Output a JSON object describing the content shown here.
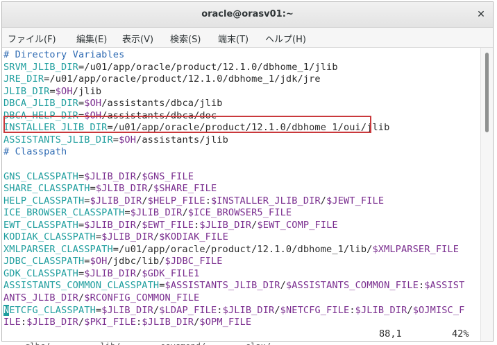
{
  "window": {
    "title": "oracle@orasv01:~"
  },
  "menu": [
    "ファイル(F)",
    "編集(E)",
    "表示(V)",
    "検索(S)",
    "端末(T)",
    "ヘルプ(H)"
  ],
  "lines": [
    [
      {
        "t": "# Directory Variables",
        "k": "c"
      }
    ],
    [
      {
        "t": "SRVM_JLIB_DIR",
        "k": "v"
      },
      {
        "t": "=/u01/app/oracle/product/12.1.0/dbhome_1/jlib",
        "k": "p"
      }
    ],
    [
      {
        "t": "JRE_DIR",
        "k": "v"
      },
      {
        "t": "=/u01/app/oracle/product/12.1.0/dbhome_1/jdk/jre",
        "k": "p"
      }
    ],
    [
      {
        "t": "JLIB_DIR",
        "k": "v"
      },
      {
        "t": "=",
        "k": "p"
      },
      {
        "t": "$OH",
        "k": "s"
      },
      {
        "t": "/jlib",
        "k": "p"
      }
    ],
    [
      {
        "t": "DBCA_JLIB_DIR",
        "k": "v"
      },
      {
        "t": "=",
        "k": "p"
      },
      {
        "t": "$OH",
        "k": "s"
      },
      {
        "t": "/assistants/dbca/jlib",
        "k": "p"
      }
    ],
    [
      {
        "t": "DBCA_HELP_DIR",
        "k": "v"
      },
      {
        "t": "=",
        "k": "p"
      },
      {
        "t": "$OH",
        "k": "s"
      },
      {
        "t": "/assistants/dbca/doc",
        "k": "p"
      }
    ],
    [
      {
        "t": "INSTALLER_JLIB_DIR",
        "k": "v"
      },
      {
        "t": "=/u01/app/oracle/product/12.1.0/dbhome_1/oui/jlib",
        "k": "p"
      }
    ],
    [
      {
        "t": "ASSISTANTS_JLIB_DIR",
        "k": "v"
      },
      {
        "t": "=",
        "k": "p"
      },
      {
        "t": "$OH",
        "k": "s"
      },
      {
        "t": "/assistants/jlib",
        "k": "p"
      }
    ],
    [
      {
        "t": "# Classpath",
        "k": "c"
      }
    ],
    [],
    [
      {
        "t": "GNS_CLASSPATH",
        "k": "v"
      },
      {
        "t": "=",
        "k": "p"
      },
      {
        "t": "$JLIB_DIR",
        "k": "s"
      },
      {
        "t": "/",
        "k": "p"
      },
      {
        "t": "$GNS_FILE",
        "k": "s"
      }
    ],
    [
      {
        "t": "SHARE_CLASSPATH",
        "k": "v"
      },
      {
        "t": "=",
        "k": "p"
      },
      {
        "t": "$JLIB_DIR",
        "k": "s"
      },
      {
        "t": "/",
        "k": "p"
      },
      {
        "t": "$SHARE_FILE",
        "k": "s"
      }
    ],
    [
      {
        "t": "HELP_CLASSPATH",
        "k": "v"
      },
      {
        "t": "=",
        "k": "p"
      },
      {
        "t": "$JLIB_DIR",
        "k": "s"
      },
      {
        "t": "/",
        "k": "p"
      },
      {
        "t": "$HELP_FILE",
        "k": "s"
      },
      {
        "t": ":",
        "k": "p"
      },
      {
        "t": "$INSTALLER_JLIB_DIR",
        "k": "s"
      },
      {
        "t": "/",
        "k": "p"
      },
      {
        "t": "$JEWT_FILE",
        "k": "s"
      }
    ],
    [
      {
        "t": "ICE_BROWSER_CLASSPATH",
        "k": "v"
      },
      {
        "t": "=",
        "k": "p"
      },
      {
        "t": "$JLIB_DIR",
        "k": "s"
      },
      {
        "t": "/",
        "k": "p"
      },
      {
        "t": "$ICE_BROWSER5_FILE",
        "k": "s"
      }
    ],
    [
      {
        "t": "EWT_CLASSPATH",
        "k": "v"
      },
      {
        "t": "=",
        "k": "p"
      },
      {
        "t": "$JLIB_DIR",
        "k": "s"
      },
      {
        "t": "/",
        "k": "p"
      },
      {
        "t": "$EWT_FILE",
        "k": "s"
      },
      {
        "t": ":",
        "k": "p"
      },
      {
        "t": "$JLIB_DIR",
        "k": "s"
      },
      {
        "t": "/",
        "k": "p"
      },
      {
        "t": "$EWT_COMP_FILE",
        "k": "s"
      }
    ],
    [
      {
        "t": "KODIAK_CLASSPATH",
        "k": "v"
      },
      {
        "t": "=",
        "k": "p"
      },
      {
        "t": "$JLIB_DIR",
        "k": "s"
      },
      {
        "t": "/",
        "k": "p"
      },
      {
        "t": "$KODIAK_FILE",
        "k": "s"
      }
    ],
    [
      {
        "t": "XMLPARSER_CLASSPATH",
        "k": "v"
      },
      {
        "t": "=/u01/app/oracle/product/12.1.0/dbhome_1/lib/",
        "k": "p"
      },
      {
        "t": "$XMLPARSER_FILE",
        "k": "s"
      }
    ],
    [
      {
        "t": "JDBC_CLASSPATH",
        "k": "v"
      },
      {
        "t": "=",
        "k": "p"
      },
      {
        "t": "$OH",
        "k": "s"
      },
      {
        "t": "/jdbc/lib/",
        "k": "p"
      },
      {
        "t": "$JDBC_FILE",
        "k": "s"
      }
    ],
    [
      {
        "t": "GDK_CLASSPATH",
        "k": "v"
      },
      {
        "t": "=",
        "k": "p"
      },
      {
        "t": "$JLIB_DIR",
        "k": "s"
      },
      {
        "t": "/",
        "k": "p"
      },
      {
        "t": "$GDK_FILE1",
        "k": "s"
      }
    ],
    [
      {
        "t": "ASSISTANTS_COMMON_CLASSPATH",
        "k": "v"
      },
      {
        "t": "=",
        "k": "p"
      },
      {
        "t": "$ASSISTANTS_JLIB_DIR",
        "k": "s"
      },
      {
        "t": "/",
        "k": "p"
      },
      {
        "t": "$ASSISTANTS_COMMON_FILE",
        "k": "s"
      },
      {
        "t": ":",
        "k": "p"
      },
      {
        "t": "$ASSIST",
        "k": "s"
      }
    ],
    [
      {
        "t": "ANTS_JLIB_DIR",
        "k": "s"
      },
      {
        "t": "/",
        "k": "p"
      },
      {
        "t": "$RCONFIG_COMMON_FILE",
        "k": "s"
      }
    ],
    [
      {
        "t": "N",
        "k": "cursor"
      },
      {
        "t": "ETCFG_CLASSPATH",
        "k": "v"
      },
      {
        "t": "=",
        "k": "p"
      },
      {
        "t": "$JLIB_DIR",
        "k": "s"
      },
      {
        "t": "/",
        "k": "p"
      },
      {
        "t": "$LDAP_FILE",
        "k": "s"
      },
      {
        "t": ":",
        "k": "p"
      },
      {
        "t": "$JLIB_DIR",
        "k": "s"
      },
      {
        "t": "/",
        "k": "p"
      },
      {
        "t": "$NETCFG_FILE",
        "k": "s"
      },
      {
        "t": ":",
        "k": "p"
      },
      {
        "t": "$JLIB_DIR",
        "k": "s"
      },
      {
        "t": "/",
        "k": "p"
      },
      {
        "t": "$OJMISC_F",
        "k": "s"
      }
    ],
    [
      {
        "t": "ILE",
        "k": "s"
      },
      {
        "t": ":",
        "k": "p"
      },
      {
        "t": "$JLIB_DIR",
        "k": "s"
      },
      {
        "t": "/",
        "k": "p"
      },
      {
        "t": "$PKI_FILE",
        "k": "s"
      },
      {
        "t": ":",
        "k": "p"
      },
      {
        "t": "$JLIB_DIR",
        "k": "s"
      },
      {
        "t": "/",
        "k": "p"
      },
      {
        "t": "$OPM_FILE",
        "k": "s"
      }
    ]
  ],
  "status": {
    "position": "88,1",
    "percent": "42%"
  },
  "behind_text": "     glbc/          lib/        osysmond/        slax/",
  "colors": {
    "variable": "#1f9e9e",
    "special": "#7a2e8f",
    "comment": "#2f6bb3",
    "highlight": "#c9383b"
  }
}
